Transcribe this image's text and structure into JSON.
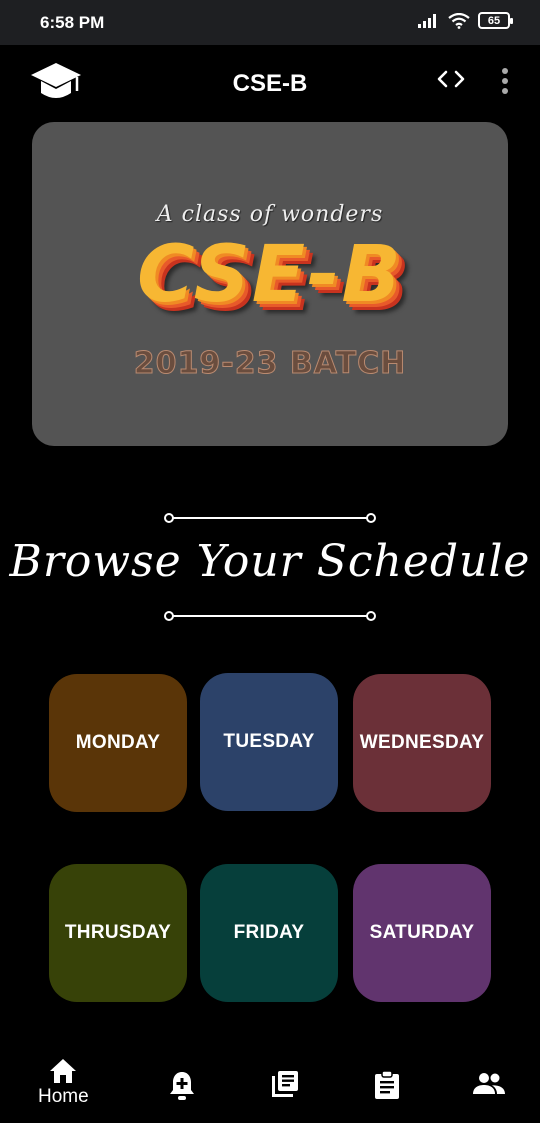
{
  "status_bar": {
    "time": "6:58 PM",
    "battery": "65",
    "icons": [
      "signal-icon",
      "wifi-icon",
      "battery-icon"
    ]
  },
  "app_bar": {
    "title": "CSE-B",
    "icons": [
      "graduation-cap-icon",
      "code-icon",
      "more-vert-icon"
    ]
  },
  "banner": {
    "tagline": "A class of wonders",
    "title": "CSE-B",
    "batch": "2019-23 BATCH"
  },
  "schedule": {
    "heading": "Browse Your Schedule",
    "days": [
      {
        "label": "MONDAY",
        "color": "#5a3508"
      },
      {
        "label": "TUESDAY",
        "color": "#2c4269"
      },
      {
        "label": "WEDNESDAY",
        "color": "#6b3038"
      },
      {
        "label": "THRUSDAY",
        "color": "#374208"
      },
      {
        "label": "FRIDAY",
        "color": "#063f3b"
      },
      {
        "label": "SATURDAY",
        "color": "#61346e"
      }
    ]
  },
  "bottom_nav": {
    "items": [
      {
        "icon": "home-icon",
        "label": "Home"
      },
      {
        "icon": "add-alert-icon"
      },
      {
        "icon": "library-books-icon"
      },
      {
        "icon": "assignment-icon"
      },
      {
        "icon": "people-icon"
      }
    ]
  }
}
